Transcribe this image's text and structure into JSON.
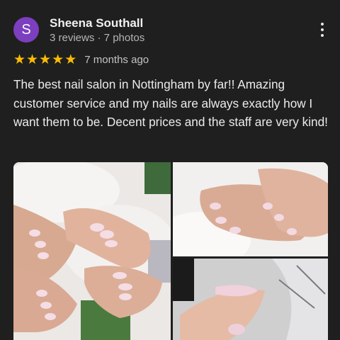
{
  "reviewer": {
    "initial": "S",
    "name": "Sheena Southall",
    "stats": "3 reviews · 7 photos"
  },
  "rating": {
    "stars": 5,
    "time_ago": "7 months ago"
  },
  "review_text": "The best nail salon in Nottingham by far!! Amazing customer service and my nails are always exactly how I want them to be. Decent prices and the staff are very kind!",
  "photos": [
    {
      "icon": "nails-photo-icon"
    },
    {
      "icon": "nails-photo-icon"
    },
    {
      "icon": "nails-photo-icon"
    }
  ],
  "colors": {
    "background": "#1f1f1f",
    "avatar": "#7b3fbf",
    "star": "#fbbc04"
  }
}
